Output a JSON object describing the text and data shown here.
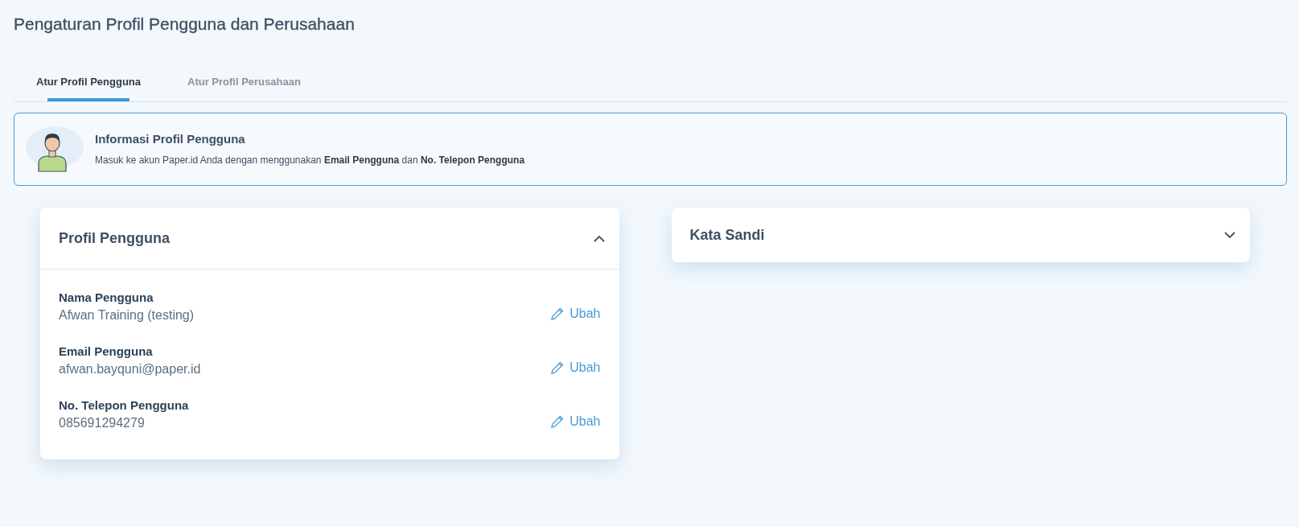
{
  "page": {
    "title": "Pengaturan Profil Pengguna dan Perusahaan"
  },
  "tabs": [
    {
      "label": "Atur Profil Pengguna",
      "selected": true
    },
    {
      "label": "Atur Profil Perusahaan",
      "selected": false
    }
  ],
  "info_banner": {
    "title": "Informasi Profil Pengguna",
    "text": "Masuk ke akun Paper.id Anda dengan menggunakan **Email Pengguna** dan **No. Telepon Pengguna**"
  },
  "cards": [
    {
      "title": "Profil Pengguna",
      "expanded": true,
      "fields": [
        {
          "label": "Nama Pengguna",
          "value": "Afwan Training (testing)",
          "action": "Ubah"
        },
        {
          "label": "Email Pengguna",
          "value": "afwan.bayquni@paper.id",
          "action": "Ubah"
        },
        {
          "label": "No. Telepon Pengguna",
          "value": "085691294279",
          "action": "Ubah"
        }
      ]
    },
    {
      "title": "Kata Sandi",
      "expanded": false
    }
  ]
}
